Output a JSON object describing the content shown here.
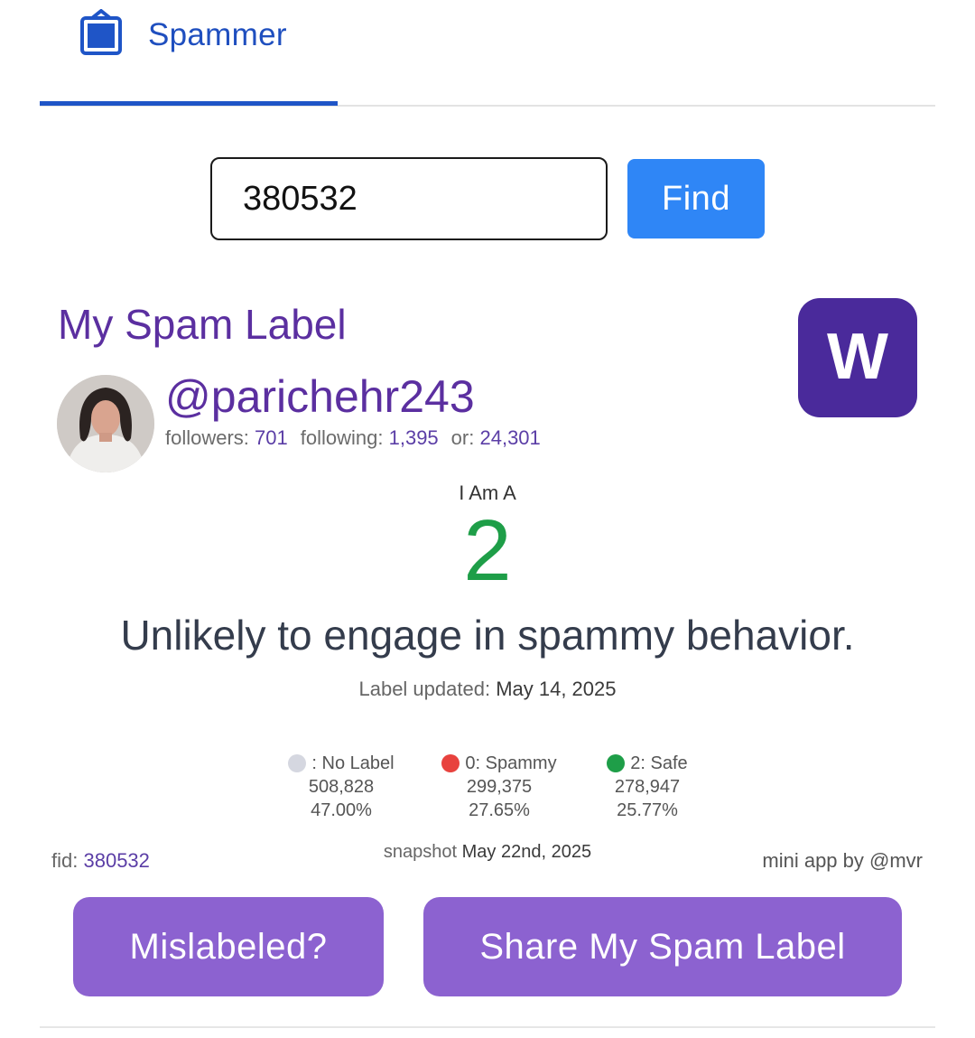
{
  "tab": {
    "label": "Spammer"
  },
  "search": {
    "value": "380532",
    "button_label": "Find"
  },
  "profile": {
    "section_title": "My Spam Label",
    "username": "@parichehr243",
    "followers_label": "followers:",
    "followers": "701",
    "following_label": "following:",
    "following": "1,395",
    "or_label": "or:",
    "or_value": "24,301",
    "logo_letter": "W"
  },
  "result": {
    "caption": "I Am A",
    "label_number": "2",
    "description": "Unlikely to engage in spammy behavior.",
    "updated_label": "Label updated:",
    "updated_date": "May 14, 2025"
  },
  "legend": [
    {
      "title": ": No Label",
      "count": "508,828",
      "percent": "47.00%",
      "color": "#d5d7e0"
    },
    {
      "title": "0: Spammy",
      "count": "299,375",
      "percent": "27.65%",
      "color": "#e8423e"
    },
    {
      "title": "2: Safe",
      "count": "278,947",
      "percent": "25.77%",
      "color": "#1e9e48"
    }
  ],
  "footer": {
    "fid_label": "fid:",
    "fid_value": "380532",
    "snapshot_label": "snapshot",
    "snapshot_date": "May 22nd, 2025",
    "credit": "mini app by @mvr"
  },
  "actions": {
    "mislabeled": "Mislabeled?",
    "share": "Share My Spam Label"
  },
  "colors": {
    "brand_purple": "#5b2fa0",
    "button_purple": "#8c62d0",
    "find_blue": "#2f86f6",
    "tab_blue": "#1f55c7",
    "safe_green": "#1e9e48"
  }
}
